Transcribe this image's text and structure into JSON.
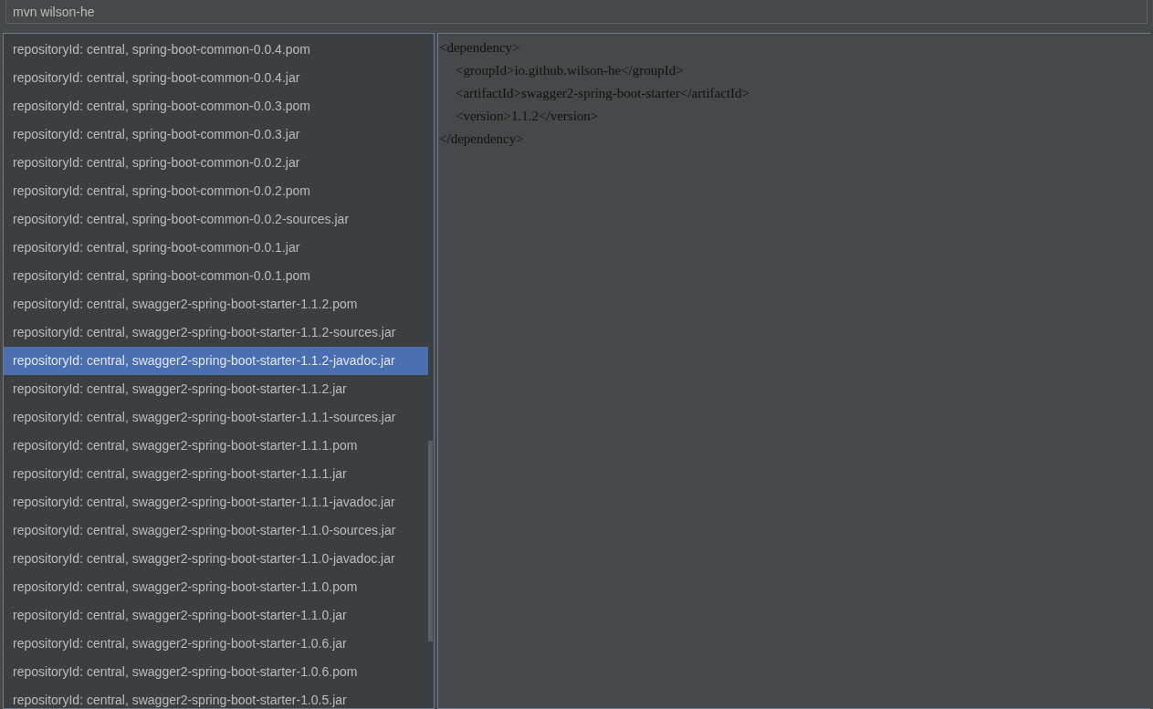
{
  "search": {
    "value": "mvn wilson-he"
  },
  "results": [
    {
      "label": "repositoryId: central, spring-boot-common-0.0.4.pom",
      "selected": false
    },
    {
      "label": "repositoryId: central, spring-boot-common-0.0.4.jar",
      "selected": false
    },
    {
      "label": "repositoryId: central, spring-boot-common-0.0.3.pom",
      "selected": false
    },
    {
      "label": "repositoryId: central, spring-boot-common-0.0.3.jar",
      "selected": false
    },
    {
      "label": "repositoryId: central, spring-boot-common-0.0.2.jar",
      "selected": false
    },
    {
      "label": "repositoryId: central, spring-boot-common-0.0.2.pom",
      "selected": false
    },
    {
      "label": "repositoryId: central, spring-boot-common-0.0.2-sources.jar",
      "selected": false
    },
    {
      "label": "repositoryId: central, spring-boot-common-0.0.1.jar",
      "selected": false
    },
    {
      "label": "repositoryId: central, spring-boot-common-0.0.1.pom",
      "selected": false
    },
    {
      "label": "repositoryId: central, swagger2-spring-boot-starter-1.1.2.pom",
      "selected": false
    },
    {
      "label": "repositoryId: central, swagger2-spring-boot-starter-1.1.2-sources.jar",
      "selected": false
    },
    {
      "label": "repositoryId: central, swagger2-spring-boot-starter-1.1.2-javadoc.jar",
      "selected": true
    },
    {
      "label": "repositoryId: central, swagger2-spring-boot-starter-1.1.2.jar",
      "selected": false
    },
    {
      "label": "repositoryId: central, swagger2-spring-boot-starter-1.1.1-sources.jar",
      "selected": false
    },
    {
      "label": "repositoryId: central, swagger2-spring-boot-starter-1.1.1.pom",
      "selected": false
    },
    {
      "label": "repositoryId: central, swagger2-spring-boot-starter-1.1.1.jar",
      "selected": false
    },
    {
      "label": "repositoryId: central, swagger2-spring-boot-starter-1.1.1-javadoc.jar",
      "selected": false
    },
    {
      "label": "repositoryId: central, swagger2-spring-boot-starter-1.1.0-sources.jar",
      "selected": false
    },
    {
      "label": "repositoryId: central, swagger2-spring-boot-starter-1.1.0-javadoc.jar",
      "selected": false
    },
    {
      "label": "repositoryId: central, swagger2-spring-boot-starter-1.1.0.pom",
      "selected": false
    },
    {
      "label": "repositoryId: central, swagger2-spring-boot-starter-1.1.0.jar",
      "selected": false
    },
    {
      "label": "repositoryId: central, swagger2-spring-boot-starter-1.0.6.jar",
      "selected": false
    },
    {
      "label": "repositoryId: central, swagger2-spring-boot-starter-1.0.6.pom",
      "selected": false
    },
    {
      "label": "repositoryId: central, swagger2-spring-boot-starter-1.0.5.jar",
      "selected": false
    }
  ],
  "editor": {
    "lines": [
      {
        "text": "<dependency>",
        "children": [
          {
            "text": "<groupId>io.github.wilson-he</groupId>"
          },
          {
            "text": "<artifactId>swagger2-spring-boot-starter</artifactId>"
          },
          {
            "text": "<version>1.1.2</version>"
          }
        ]
      },
      {
        "text": "</dependency>"
      }
    ]
  }
}
